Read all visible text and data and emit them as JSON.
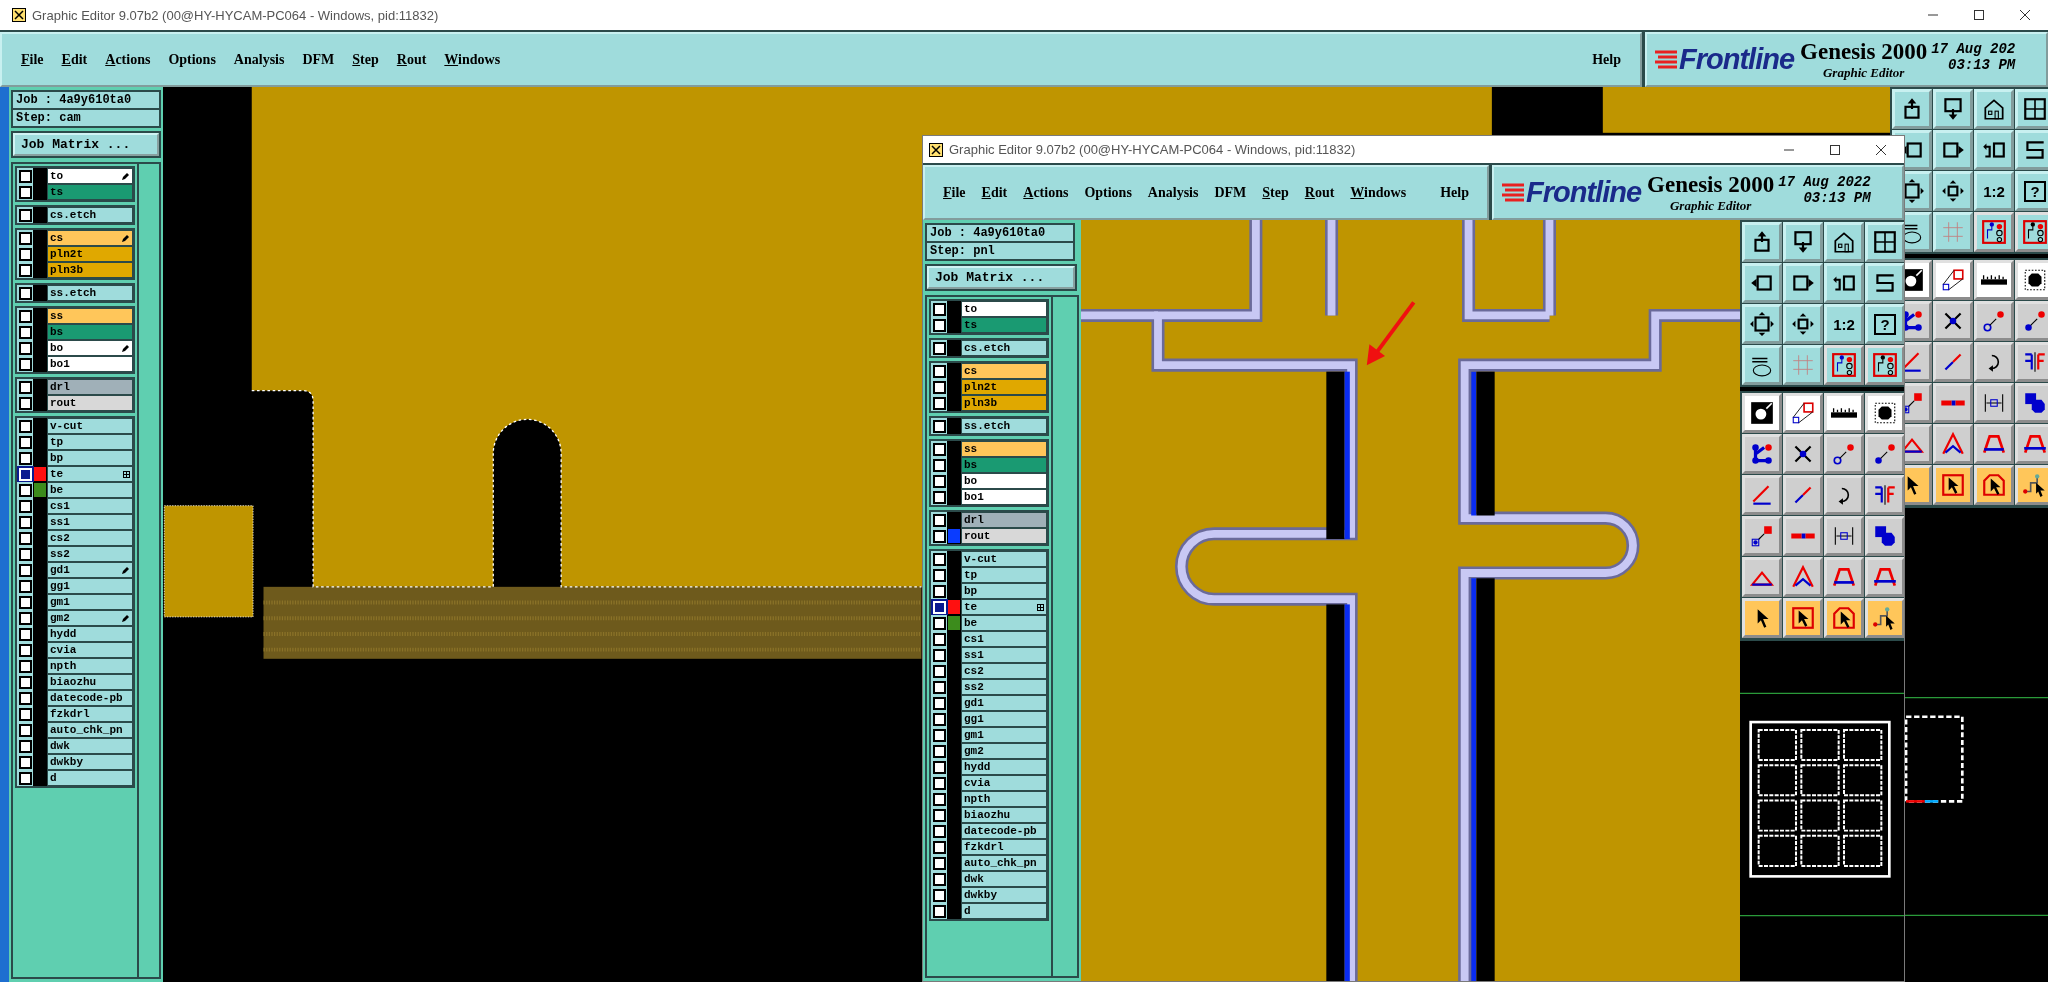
{
  "windows": [
    {
      "title": "Graphic Editor 9.07b2 (00@HY-HYCAM-PC064 - Windows, pid:11832)",
      "menu": [
        {
          "label": "File",
          "mnemonic": true
        },
        {
          "label": "Edit",
          "mnemonic": true
        },
        {
          "label": "Actions",
          "mnemonic": true
        },
        {
          "label": "Options",
          "mnemonic": false
        },
        {
          "label": "Analysis",
          "mnemonic": false
        },
        {
          "label": "DFM",
          "mnemonic": false
        },
        {
          "label": "Step",
          "mnemonic": true
        },
        {
          "label": "Rout",
          "mnemonic": true
        },
        {
          "label": "Windows",
          "mnemonic": true
        }
      ],
      "help": "Help",
      "logo": {
        "brand": "Frontline",
        "product": "Genesis 2000",
        "subtitle": "Graphic Editor",
        "date": "17 Aug 202",
        "time": "03:13 PM"
      },
      "job": "Job : 4a9y610ta0",
      "step": "Step: cam",
      "matrix_button": "Job Matrix ...",
      "layer_groups": [
        {
          "layers": [
            {
              "name": "to",
              "kind": "silk",
              "selected": false,
              "marked": true,
              "boxed": false
            },
            {
              "name": "ts",
              "kind": "mask",
              "selected": false,
              "marked": false,
              "boxed": false
            }
          ]
        },
        {
          "layers": [
            {
              "name": "cs.etch",
              "kind": "doc",
              "selected": false,
              "marked": false,
              "boxed": false
            }
          ]
        },
        {
          "layers": [
            {
              "name": "cs",
              "kind": "signal",
              "selected": false,
              "marked": true,
              "boxed": false
            },
            {
              "name": "pln2t",
              "kind": "power",
              "selected": false,
              "marked": false,
              "boxed": false
            },
            {
              "name": "pln3b",
              "kind": "power",
              "selected": false,
              "marked": false,
              "boxed": false
            }
          ]
        },
        {
          "layers": [
            {
              "name": "ss.etch",
              "kind": "doc",
              "selected": false,
              "marked": false,
              "boxed": false
            }
          ]
        },
        {
          "layers": [
            {
              "name": "ss",
              "kind": "signal",
              "selected": false,
              "marked": false,
              "boxed": false
            },
            {
              "name": "bs",
              "kind": "mask",
              "selected": false,
              "marked": false,
              "boxed": false
            },
            {
              "name": "bo",
              "kind": "silk",
              "selected": false,
              "marked": true,
              "boxed": false
            },
            {
              "name": "bo1",
              "kind": "silk",
              "selected": false,
              "marked": false,
              "boxed": false
            }
          ]
        },
        {
          "layers": [
            {
              "name": "drl",
              "kind": "drill",
              "selected": false,
              "marked": false,
              "boxed": false
            },
            {
              "name": "rout",
              "kind": "rout",
              "selected": false,
              "marked": false,
              "boxed": false
            }
          ]
        },
        {
          "layers": [
            {
              "name": "v-cut",
              "kind": "doc",
              "selected": false,
              "marked": false,
              "boxed": false
            },
            {
              "name": "tp",
              "kind": "doc",
              "selected": false,
              "marked": false,
              "boxed": false
            },
            {
              "name": "bp",
              "kind": "doc",
              "selected": false,
              "marked": false,
              "boxed": false
            },
            {
              "name": "te",
              "kind": "doc",
              "selected": true,
              "marked": false,
              "boxed": true,
              "color": "#ff1010"
            },
            {
              "name": "be",
              "kind": "doc",
              "selected": false,
              "marked": false,
              "boxed": false,
              "color": "#3c8c1c"
            },
            {
              "name": "cs1",
              "kind": "doc",
              "selected": false,
              "marked": false,
              "boxed": false
            },
            {
              "name": "ss1",
              "kind": "doc",
              "selected": false,
              "marked": false,
              "boxed": false
            },
            {
              "name": "cs2",
              "kind": "doc",
              "selected": false,
              "marked": false,
              "boxed": false
            },
            {
              "name": "ss2",
              "kind": "doc",
              "selected": false,
              "marked": false,
              "boxed": false
            },
            {
              "name": "gd1",
              "kind": "doc",
              "selected": false,
              "marked": true,
              "boxed": false
            },
            {
              "name": "gg1",
              "kind": "doc",
              "selected": false,
              "marked": false,
              "boxed": false
            },
            {
              "name": "gm1",
              "kind": "doc",
              "selected": false,
              "marked": false,
              "boxed": false
            },
            {
              "name": "gm2",
              "kind": "doc",
              "selected": false,
              "marked": true,
              "boxed": false
            },
            {
              "name": "hydd",
              "kind": "doc",
              "selected": false,
              "marked": false,
              "boxed": false
            },
            {
              "name": "cvia",
              "kind": "doc",
              "selected": false,
              "marked": false,
              "boxed": false
            },
            {
              "name": "npth",
              "kind": "doc",
              "selected": false,
              "marked": false,
              "boxed": false
            },
            {
              "name": "biaozhu",
              "kind": "doc",
              "selected": false,
              "marked": false,
              "boxed": false
            },
            {
              "name": "datecode-pb",
              "kind": "doc",
              "selected": false,
              "marked": false,
              "boxed": false
            },
            {
              "name": "fzkdrl",
              "kind": "doc",
              "selected": false,
              "marked": false,
              "boxed": false
            },
            {
              "name": "auto_chk_pn",
              "kind": "doc",
              "selected": false,
              "marked": false,
              "boxed": false
            },
            {
              "name": "dwk",
              "kind": "doc",
              "selected": false,
              "marked": false,
              "boxed": false
            },
            {
              "name": "dwkby",
              "kind": "doc",
              "selected": false,
              "marked": false,
              "boxed": false
            },
            {
              "name": "d",
              "kind": "doc",
              "selected": false,
              "marked": false,
              "boxed": false
            }
          ]
        }
      ],
      "toolbar": {
        "scale": "1:2",
        "help": "?"
      }
    },
    {
      "title": "Graphic Editor 9.07b2 (00@HY-HYCAM-PC064 - Windows, pid:11832)",
      "menu": [
        {
          "label": "File",
          "mnemonic": true
        },
        {
          "label": "Edit",
          "mnemonic": true
        },
        {
          "label": "Actions",
          "mnemonic": true
        },
        {
          "label": "Options",
          "mnemonic": false
        },
        {
          "label": "Analysis",
          "mnemonic": false
        },
        {
          "label": "DFM",
          "mnemonic": false
        },
        {
          "label": "Step",
          "mnemonic": true
        },
        {
          "label": "Rout",
          "mnemonic": true
        },
        {
          "label": "Windows",
          "mnemonic": true
        }
      ],
      "help": "Help",
      "logo": {
        "brand": "Frontline",
        "product": "Genesis 2000",
        "subtitle": "Graphic Editor",
        "date": "17 Aug 2022",
        "time": "03:13 PM"
      },
      "job": "Job : 4a9y610ta0",
      "step": "Step: pnl",
      "matrix_button": "Job Matrix ...",
      "layer_groups": [
        {
          "layers": [
            {
              "name": "to",
              "kind": "silk",
              "selected": false,
              "boxed": false
            },
            {
              "name": "ts",
              "kind": "mask",
              "selected": false,
              "boxed": false
            }
          ]
        },
        {
          "layers": [
            {
              "name": "cs.etch",
              "kind": "doc",
              "selected": false,
              "boxed": false
            }
          ]
        },
        {
          "layers": [
            {
              "name": "cs",
              "kind": "signal",
              "selected": false,
              "boxed": false
            },
            {
              "name": "pln2t",
              "kind": "power",
              "selected": false,
              "boxed": false
            },
            {
              "name": "pln3b",
              "kind": "power",
              "selected": false,
              "boxed": false
            }
          ]
        },
        {
          "layers": [
            {
              "name": "ss.etch",
              "kind": "doc",
              "selected": false,
              "boxed": false
            }
          ]
        },
        {
          "layers": [
            {
              "name": "ss",
              "kind": "signal",
              "selected": false,
              "boxed": false
            },
            {
              "name": "bs",
              "kind": "mask",
              "selected": false,
              "boxed": false
            },
            {
              "name": "bo",
              "kind": "silk",
              "selected": false,
              "boxed": false
            },
            {
              "name": "bo1",
              "kind": "silk",
              "selected": false,
              "boxed": false
            }
          ]
        },
        {
          "layers": [
            {
              "name": "drl",
              "kind": "drill",
              "selected": false,
              "boxed": false
            },
            {
              "name": "rout",
              "kind": "rout",
              "selected": false,
              "boxed": false,
              "color": "#0a3cff"
            }
          ]
        },
        {
          "layers": [
            {
              "name": "v-cut",
              "kind": "doc",
              "selected": false,
              "boxed": false
            },
            {
              "name": "tp",
              "kind": "doc",
              "selected": false,
              "boxed": false
            },
            {
              "name": "bp",
              "kind": "doc",
              "selected": false,
              "boxed": false
            },
            {
              "name": "te",
              "kind": "doc",
              "selected": true,
              "boxed": true,
              "color": "#ff1010"
            },
            {
              "name": "be",
              "kind": "doc",
              "selected": false,
              "boxed": false,
              "color": "#3c8c1c"
            },
            {
              "name": "cs1",
              "kind": "doc",
              "selected": false,
              "boxed": false
            },
            {
              "name": "ss1",
              "kind": "doc",
              "selected": false,
              "boxed": false
            },
            {
              "name": "cs2",
              "kind": "doc",
              "selected": false,
              "boxed": false
            },
            {
              "name": "ss2",
              "kind": "doc",
              "selected": false,
              "boxed": false
            },
            {
              "name": "gd1",
              "kind": "doc",
              "selected": false,
              "boxed": false
            },
            {
              "name": "gg1",
              "kind": "doc",
              "selected": false,
              "boxed": false
            },
            {
              "name": "gm1",
              "kind": "doc",
              "selected": false,
              "boxed": false
            },
            {
              "name": "gm2",
              "kind": "doc",
              "selected": false,
              "boxed": false
            },
            {
              "name": "hydd",
              "kind": "doc",
              "selected": false,
              "boxed": false
            },
            {
              "name": "cvia",
              "kind": "doc",
              "selected": false,
              "boxed": false
            },
            {
              "name": "npth",
              "kind": "doc",
              "selected": false,
              "boxed": false
            },
            {
              "name": "biaozhu",
              "kind": "doc",
              "selected": false,
              "boxed": false
            },
            {
              "name": "datecode-pb",
              "kind": "doc",
              "selected": false,
              "boxed": false
            },
            {
              "name": "fzkdrl",
              "kind": "doc",
              "selected": false,
              "boxed": false
            },
            {
              "name": "auto_chk_pn",
              "kind": "doc",
              "selected": false,
              "boxed": false
            },
            {
              "name": "dwk",
              "kind": "doc",
              "selected": false,
              "boxed": false
            },
            {
              "name": "dwkby",
              "kind": "doc",
              "selected": false,
              "boxed": false
            },
            {
              "name": "d",
              "kind": "doc",
              "selected": false,
              "boxed": false
            }
          ]
        }
      ],
      "toolbar": {
        "scale": "1:2",
        "help": "?"
      }
    }
  ]
}
